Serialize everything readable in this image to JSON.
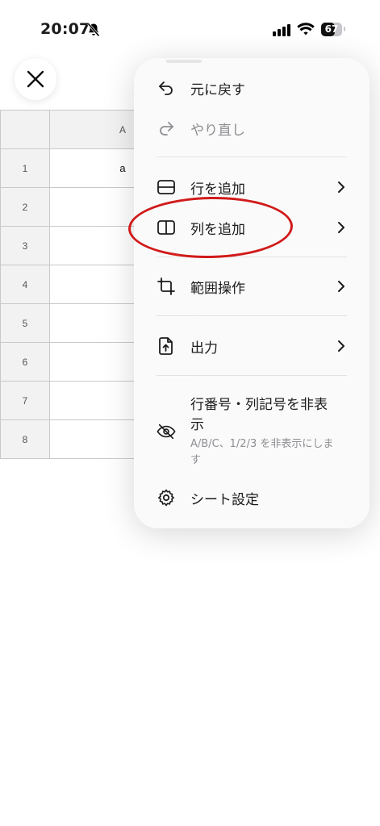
{
  "status_bar": {
    "time": "20:07",
    "battery_level": "67",
    "icons": [
      "silent-bell-icon",
      "cellular-signal-icon",
      "wifi-icon",
      "battery-icon"
    ]
  },
  "close_icon": "close-icon",
  "sheet": {
    "column_headers": [
      "A"
    ],
    "rows": [
      {
        "number": "1",
        "a": "a"
      },
      {
        "number": "2",
        "a": ""
      },
      {
        "number": "3",
        "a": ""
      },
      {
        "number": "4",
        "a": ""
      },
      {
        "number": "5",
        "a": ""
      },
      {
        "number": "6",
        "a": ""
      },
      {
        "number": "7",
        "a": ""
      },
      {
        "number": "8",
        "a": ""
      }
    ]
  },
  "menu": {
    "undo": {
      "label": "元に戻す",
      "icon": "undo-icon"
    },
    "redo": {
      "label": "やり直し",
      "icon": "redo-icon",
      "disabled": true
    },
    "add_row": {
      "label": "行を追加",
      "icon": "add-row-icon"
    },
    "add_column": {
      "label": "列を追加",
      "icon": "add-column-icon",
      "highlighted": true
    },
    "range_ops": {
      "label": "範囲操作",
      "icon": "crop-icon"
    },
    "export": {
      "label": "出力",
      "icon": "export-file-icon"
    },
    "hide_headers": {
      "title": "行番号・列記号を非表示",
      "subtitle": "A/B/C、1/2/3 を非表示にします",
      "icon": "eye-slash-icon"
    },
    "sheet_settings": {
      "label": "シート設定",
      "icon": "gear-icon"
    }
  },
  "colors": {
    "highlight": "#d11a1a",
    "header_bg": "#f2f2f2",
    "grid_line": "#c9c9c9",
    "disabled_text": "#8e8e93"
  }
}
